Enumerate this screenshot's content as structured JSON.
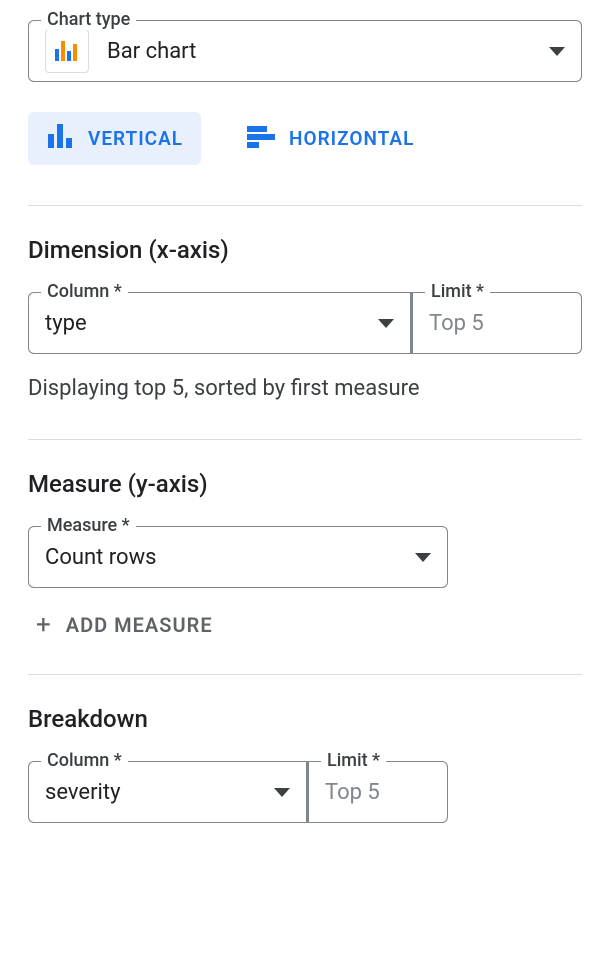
{
  "chart_type": {
    "legend": "Chart type",
    "value": "Bar chart"
  },
  "orientation": {
    "vertical": "VERTICAL",
    "horizontal": "HORIZONTAL"
  },
  "dimension": {
    "title": "Dimension (x-axis)",
    "column_legend": "Column *",
    "column_value": "type",
    "limit_legend": "Limit *",
    "limit_value": "Top 5",
    "info": "Displaying top 5, sorted by first measure"
  },
  "measure": {
    "title": "Measure (y-axis)",
    "legend": "Measure *",
    "value": "Count rows",
    "add_label": "ADD MEASURE"
  },
  "breakdown": {
    "title": "Breakdown",
    "column_legend": "Column *",
    "column_value": "severity",
    "limit_legend": "Limit *",
    "limit_value": "Top 5"
  }
}
